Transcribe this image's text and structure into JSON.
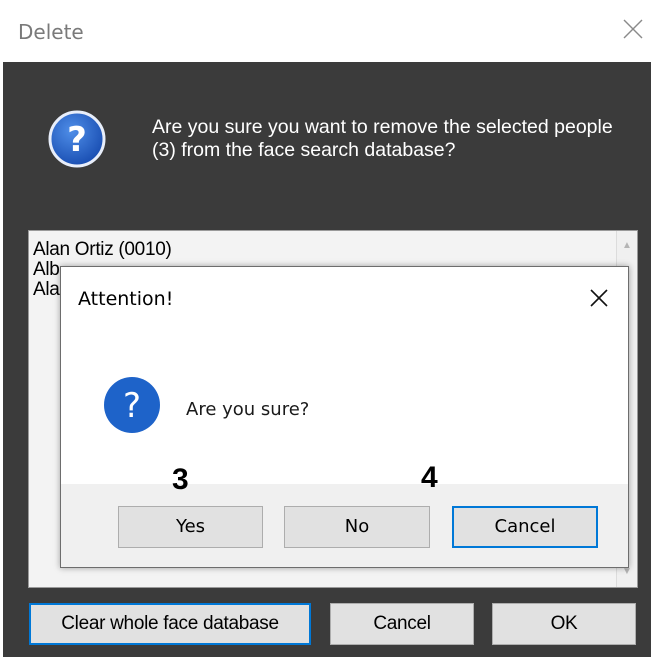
{
  "outer_dialog": {
    "title": "Delete",
    "message": "Are you sure you want to remove the selected people (3) from the face search database?",
    "people": [
      "Alan Ortiz  (0010)",
      "Alb",
      "Ala"
    ],
    "buttons": {
      "clear_all": "Clear whole face database",
      "cancel": "Cancel",
      "ok": "OK"
    }
  },
  "attention_dialog": {
    "title": "Attention!",
    "message": "Are you sure?",
    "buttons": {
      "yes": "Yes",
      "no": "No",
      "cancel": "Cancel"
    }
  },
  "annotations": {
    "step_yes": "3",
    "step_cancel": "4"
  },
  "icons": {
    "outer": "question-icon",
    "attention": "question-icon",
    "close": "close-icon"
  },
  "colors": {
    "dialog_body": "#3b3b3b",
    "accent": "#0078d7",
    "question_icon": "#1e63c9"
  }
}
